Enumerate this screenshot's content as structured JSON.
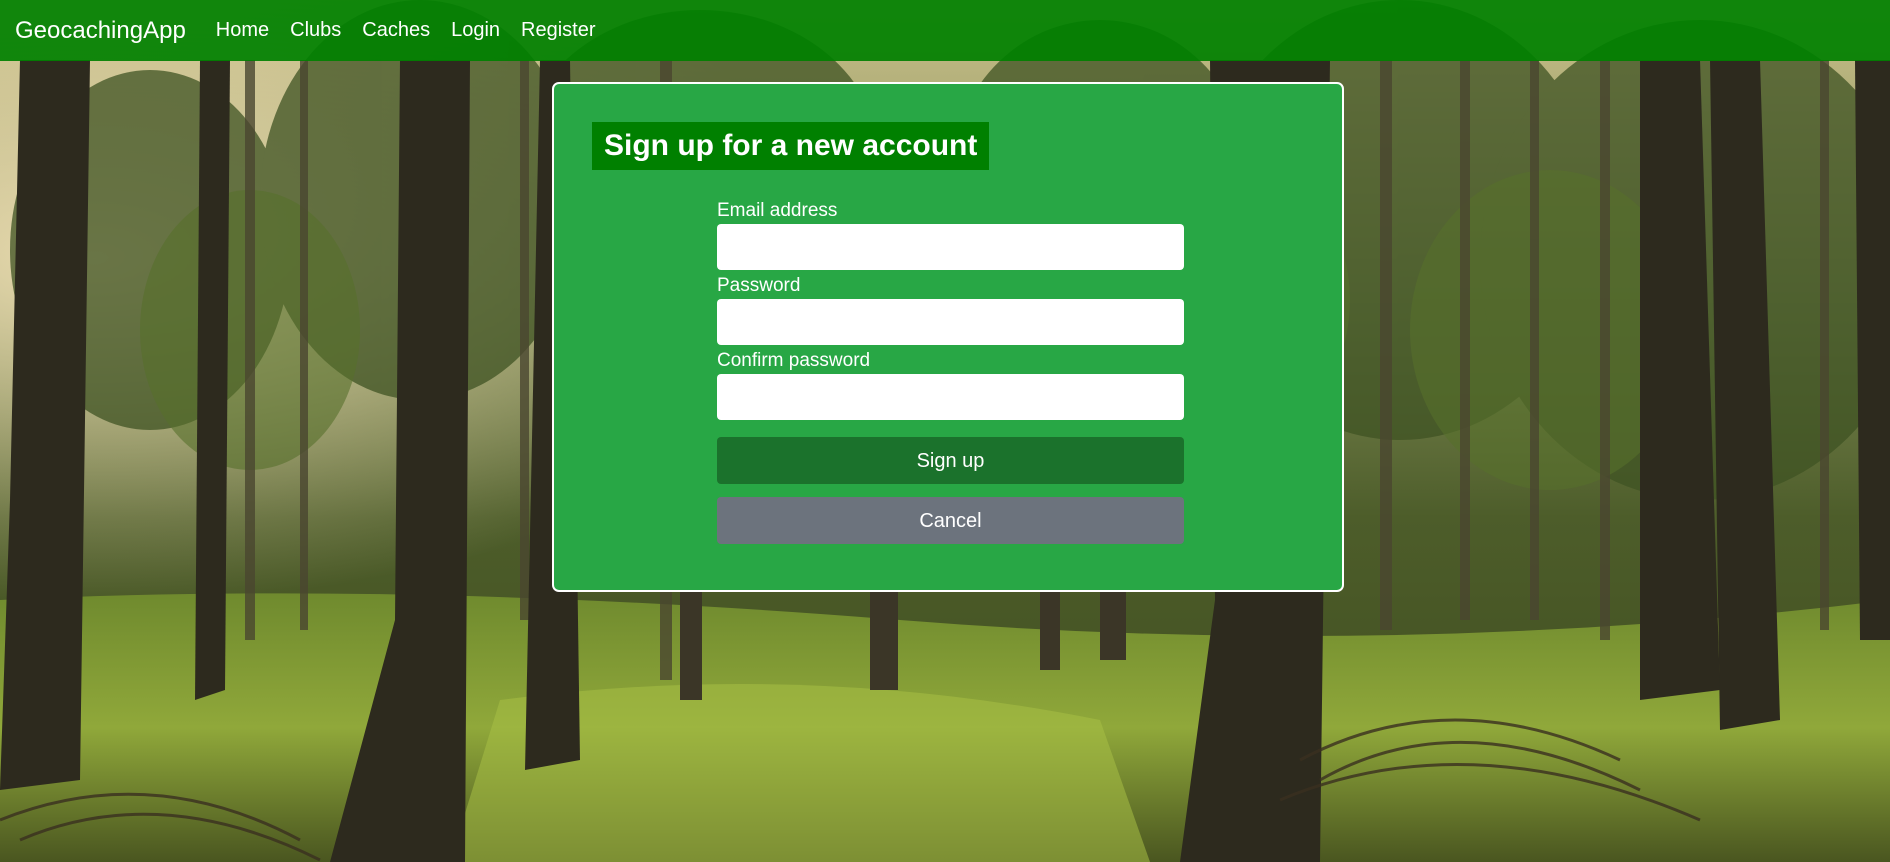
{
  "navbar": {
    "brand": "GeocachingApp",
    "links": [
      {
        "label": "Home"
      },
      {
        "label": "Clubs"
      },
      {
        "label": "Caches"
      },
      {
        "label": "Login"
      },
      {
        "label": "Register"
      }
    ]
  },
  "card": {
    "title": "Sign up for a new account",
    "fields": [
      {
        "label": "Email address",
        "value": "",
        "placeholder": ""
      },
      {
        "label": "Password",
        "value": "",
        "placeholder": ""
      },
      {
        "label": "Confirm password",
        "value": "",
        "placeholder": ""
      }
    ],
    "submit_label": "Sign up",
    "cancel_label": "Cancel"
  },
  "colors": {
    "navbar": "#008000",
    "card": "#28a745",
    "title_bg": "#008000",
    "submit_button": "#1b722c",
    "cancel_button": "#6c737d"
  },
  "background": {
    "description_icon": "forest-background-image"
  }
}
